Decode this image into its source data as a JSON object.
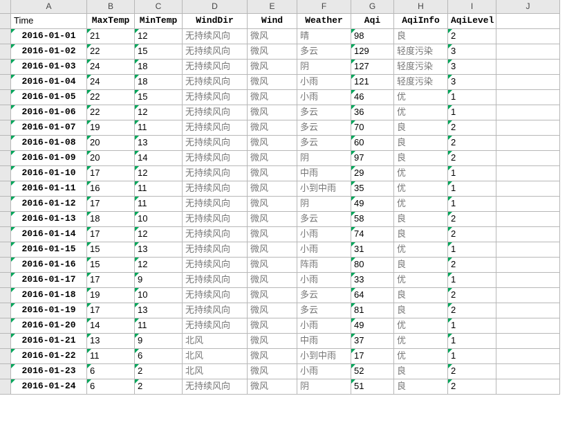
{
  "columns": [
    "",
    "A",
    "B",
    "C",
    "D",
    "E",
    "F",
    "G",
    "H",
    "I",
    "J"
  ],
  "headers": [
    "Time",
    "MaxTemp",
    "MinTemp",
    "WindDir",
    "Wind",
    "Weather",
    "Aqi",
    "AqiInfo",
    "AqiLevel"
  ],
  "rows": [
    {
      "time": "2016-01-01",
      "max": "21",
      "min": "12",
      "winddir": "无持续风向",
      "wind": "微风",
      "weather": "晴",
      "aqi": "98",
      "aqiinfo": "良",
      "aqilevel": "2"
    },
    {
      "time": "2016-01-02",
      "max": "22",
      "min": "15",
      "winddir": "无持续风向",
      "wind": "微风",
      "weather": "多云",
      "aqi": "129",
      "aqiinfo": "轻度污染",
      "aqilevel": "3"
    },
    {
      "time": "2016-01-03",
      "max": "24",
      "min": "18",
      "winddir": "无持续风向",
      "wind": "微风",
      "weather": "阴",
      "aqi": "127",
      "aqiinfo": "轻度污染",
      "aqilevel": "3"
    },
    {
      "time": "2016-01-04",
      "max": "24",
      "min": "18",
      "winddir": "无持续风向",
      "wind": "微风",
      "weather": "小雨",
      "aqi": "121",
      "aqiinfo": "轻度污染",
      "aqilevel": "3"
    },
    {
      "time": "2016-01-05",
      "max": "22",
      "min": "15",
      "winddir": "无持续风向",
      "wind": "微风",
      "weather": "小雨",
      "aqi": "46",
      "aqiinfo": "优",
      "aqilevel": "1"
    },
    {
      "time": "2016-01-06",
      "max": "22",
      "min": "12",
      "winddir": "无持续风向",
      "wind": "微风",
      "weather": "多云",
      "aqi": "36",
      "aqiinfo": "优",
      "aqilevel": "1"
    },
    {
      "time": "2016-01-07",
      "max": "19",
      "min": "11",
      "winddir": "无持续风向",
      "wind": "微风",
      "weather": "多云",
      "aqi": "70",
      "aqiinfo": "良",
      "aqilevel": "2"
    },
    {
      "time": "2016-01-08",
      "max": "20",
      "min": "13",
      "winddir": "无持续风向",
      "wind": "微风",
      "weather": "多云",
      "aqi": "60",
      "aqiinfo": "良",
      "aqilevel": "2"
    },
    {
      "time": "2016-01-09",
      "max": "20",
      "min": "14",
      "winddir": "无持续风向",
      "wind": "微风",
      "weather": "阴",
      "aqi": "97",
      "aqiinfo": "良",
      "aqilevel": "2"
    },
    {
      "time": "2016-01-10",
      "max": "17",
      "min": "12",
      "winddir": "无持续风向",
      "wind": "微风",
      "weather": "中雨",
      "aqi": "29",
      "aqiinfo": "优",
      "aqilevel": "1"
    },
    {
      "time": "2016-01-11",
      "max": "16",
      "min": "11",
      "winddir": "无持续风向",
      "wind": "微风",
      "weather": "小到中雨",
      "aqi": "35",
      "aqiinfo": "优",
      "aqilevel": "1"
    },
    {
      "time": "2016-01-12",
      "max": "17",
      "min": "11",
      "winddir": "无持续风向",
      "wind": "微风",
      "weather": "阴",
      "aqi": "49",
      "aqiinfo": "优",
      "aqilevel": "1"
    },
    {
      "time": "2016-01-13",
      "max": "18",
      "min": "10",
      "winddir": "无持续风向",
      "wind": "微风",
      "weather": "多云",
      "aqi": "58",
      "aqiinfo": "良",
      "aqilevel": "2"
    },
    {
      "time": "2016-01-14",
      "max": "17",
      "min": "12",
      "winddir": "无持续风向",
      "wind": "微风",
      "weather": "小雨",
      "aqi": "74",
      "aqiinfo": "良",
      "aqilevel": "2"
    },
    {
      "time": "2016-01-15",
      "max": "15",
      "min": "13",
      "winddir": "无持续风向",
      "wind": "微风",
      "weather": "小雨",
      "aqi": "31",
      "aqiinfo": "优",
      "aqilevel": "1"
    },
    {
      "time": "2016-01-16",
      "max": "15",
      "min": "12",
      "winddir": "无持续风向",
      "wind": "微风",
      "weather": "阵雨",
      "aqi": "80",
      "aqiinfo": "良",
      "aqilevel": "2"
    },
    {
      "time": "2016-01-17",
      "max": "17",
      "min": "9",
      "winddir": "无持续风向",
      "wind": "微风",
      "weather": "小雨",
      "aqi": "33",
      "aqiinfo": "优",
      "aqilevel": "1"
    },
    {
      "time": "2016-01-18",
      "max": "19",
      "min": "10",
      "winddir": "无持续风向",
      "wind": "微风",
      "weather": "多云",
      "aqi": "64",
      "aqiinfo": "良",
      "aqilevel": "2"
    },
    {
      "time": "2016-01-19",
      "max": "17",
      "min": "13",
      "winddir": "无持续风向",
      "wind": "微风",
      "weather": "多云",
      "aqi": "81",
      "aqiinfo": "良",
      "aqilevel": "2"
    },
    {
      "time": "2016-01-20",
      "max": "14",
      "min": "11",
      "winddir": "无持续风向",
      "wind": "微风",
      "weather": "小雨",
      "aqi": "49",
      "aqiinfo": "优",
      "aqilevel": "1"
    },
    {
      "time": "2016-01-21",
      "max": "13",
      "min": "9",
      "winddir": "北风",
      "wind": "微风",
      "weather": "中雨",
      "aqi": "37",
      "aqiinfo": "优",
      "aqilevel": "1"
    },
    {
      "time": "2016-01-22",
      "max": "11",
      "min": "6",
      "winddir": "北风",
      "wind": "微风",
      "weather": "小到中雨",
      "aqi": "17",
      "aqiinfo": "优",
      "aqilevel": "1"
    },
    {
      "time": "2016-01-23",
      "max": "6",
      "min": "2",
      "winddir": "北风",
      "wind": "微风",
      "weather": "小雨",
      "aqi": "52",
      "aqiinfo": "良",
      "aqilevel": "2"
    },
    {
      "time": "2016-01-24",
      "max": "6",
      "min": "2",
      "winddir": "无持续风向",
      "wind": "微风",
      "weather": "阴",
      "aqi": "51",
      "aqiinfo": "良",
      "aqilevel": "2"
    }
  ]
}
